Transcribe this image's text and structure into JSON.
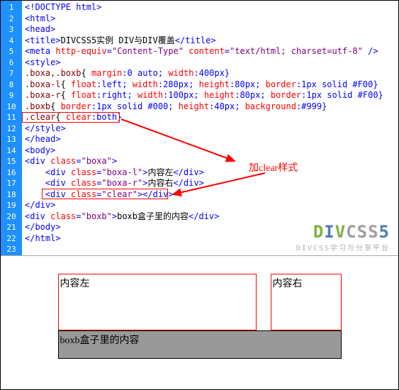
{
  "gutter": [
    "1",
    "2",
    "3",
    "4",
    "5",
    "6",
    "7",
    "8",
    "9",
    "10",
    "11",
    "12",
    "13",
    "14",
    "15",
    "16",
    "17",
    "18",
    "19",
    "20",
    "21",
    "22",
    "23"
  ],
  "code": {
    "l1": {
      "a": "<!",
      "b": "DOCTYPE ",
      "c": "html>"
    },
    "l2": {
      "a": "<",
      "b": "html",
      "c": ">"
    },
    "l3": {
      "a": "<",
      "b": "head",
      "c": ">"
    },
    "l4": {
      "a": "<",
      "b": "title",
      "c": ">",
      "t": "DIVCSS5实例 DIV与DIV覆盖",
      "d": "</",
      "e": "title",
      "f": ">"
    },
    "l5": {
      "a": "<",
      "b": "meta ",
      "c": "http-equiv",
      "d": "=",
      "e": "\"Content-Type\"",
      "f": " content",
      "g": "=",
      "h": "\"text/html; charset=utf-8\"",
      "i": " />"
    },
    "l6": {
      "a": "<",
      "b": "style",
      "c": ">"
    },
    "l7": {
      "s": ".boxa,.boxb",
      "b": "{ ",
      "p1": "margin",
      "v1": ":0 auto; ",
      "p2": "width",
      "v2": ":400px}"
    },
    "l8": {
      "s": ".boxa-l",
      "b": "{ ",
      "p1": "float",
      "v1": ":left; ",
      "p2": "width",
      "v2": ":280px; ",
      "p3": "height",
      "v3": ":80px; ",
      "p4": "border",
      "v4": ":1px solid #F00}"
    },
    "l9": {
      "s": ".boxa-r",
      "b": "{ ",
      "p1": "float",
      "v1": ":right; ",
      "p2": "width",
      "v2": ":100px; ",
      "p3": "height",
      "v3": ":80px; ",
      "p4": "border",
      "v4": ":1px solid #F00}"
    },
    "l10": {
      "s": ".boxb",
      "b": "{ ",
      "p1": "border",
      "v1": ":1px solid #000; ",
      "p2": "height",
      "v2": ":40px; ",
      "p3": "background",
      "v3": ":#999}"
    },
    "l11": {
      "s": ".clear",
      "b": "{ ",
      "p1": "clear",
      "v1": ":both}"
    },
    "l12": {
      "a": "</",
      "b": "style",
      "c": ">"
    },
    "l13": {
      "a": "</",
      "b": "head",
      "c": ">"
    },
    "l14": {
      "a": "<",
      "b": "body",
      "c": ">"
    },
    "l15": {
      "a": "<",
      "b": "div ",
      "c": "class",
      "d": "=",
      "e": "\"boxa\"",
      "f": ">"
    },
    "l16": {
      "a": "<",
      "b": "div ",
      "c": "class",
      "d": "=",
      "e": "\"boxa-l\"",
      "f": ">",
      "t": "内容左",
      "g": "</",
      "h": "div",
      "i": ">"
    },
    "l17": {
      "a": "<",
      "b": "div ",
      "c": "class",
      "d": "=",
      "e": "\"boxa-r\"",
      "f": ">",
      "t": "内容右",
      "g": "</",
      "h": "div",
      "i": ">"
    },
    "l18": {
      "a": "<",
      "b": "div ",
      "c": "class",
      "d": "=",
      "e": "\"clear\"",
      "f": "></",
      "g": "div",
      "h": ">"
    },
    "l19": {
      "a": "</",
      "b": "div",
      "c": ">"
    },
    "l20": {
      "a": "<",
      "b": "div ",
      "c": "class",
      "d": "=",
      "e": "\"boxb\"",
      "f": ">",
      "t": "boxb盒子里的内容",
      "g": "</",
      "h": "div",
      "i": ">"
    },
    "l21": {
      "a": "</",
      "b": "body",
      "c": ">"
    },
    "l22": {
      "a": "</",
      "b": "html",
      "c": ">"
    }
  },
  "annotation": "加clear样式",
  "watermark": {
    "main": "DIVCSS5",
    "sub": "DIVCSS学习与分享平台"
  },
  "preview": {
    "left": "内容左",
    "right": "内容右",
    "boxb": "boxb盒子里的内容"
  }
}
